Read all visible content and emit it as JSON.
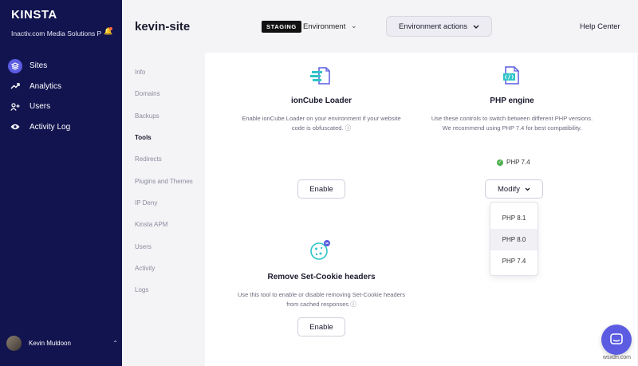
{
  "sidebar": {
    "logo": "KINSTA",
    "company": "Inactiv.com Media Solutions P",
    "bell_icon": "bell-icon",
    "items": [
      {
        "label": "Sites",
        "icon": "layers-icon",
        "active": true
      },
      {
        "label": "Analytics",
        "icon": "trend-icon",
        "active": false
      },
      {
        "label": "Users",
        "icon": "user-plus-icon",
        "active": false
      },
      {
        "label": "Activity Log",
        "icon": "eye-icon",
        "active": false
      }
    ],
    "user": {
      "name": "Kevin Muldoon",
      "caret": "⌃"
    }
  },
  "header": {
    "site_title": "kevin-site",
    "environment_badge": "STAGING",
    "environment_label": "Environment",
    "environment_caret": "⌄",
    "environment_actions": "Environment actions",
    "help": "Help Center"
  },
  "subnav": [
    "Info",
    "Domains",
    "Backups",
    "Tools",
    "Redirects",
    "Plugins and Themes",
    "IP Deny",
    "Kinsta APM",
    "Users",
    "Activity",
    "Logs"
  ],
  "subnav_active": "Tools",
  "tools": {
    "ioncube": {
      "title": "ionCube Loader",
      "description": "Enable ionCube Loader on your environment if your website code is obfuscated.",
      "button": "Enable"
    },
    "php": {
      "title": "PHP engine",
      "description": "Use these controls to switch between different PHP versions. We recommend using PHP 7.4 for best compatibility.",
      "status": "PHP 7.4",
      "button": "Modify",
      "options": [
        "PHP 8.1",
        "PHP 8.0",
        "PHP 7.4"
      ],
      "hovered_option": "PHP 8.0"
    },
    "cookie": {
      "title": "Remove Set-Cookie headers",
      "description": "Use this tool to enable or disable removing Set-Cookie headers from cached responses",
      "button": "Enable"
    }
  },
  "colors": {
    "sidebar": "#12144f",
    "accent": "#5b5ce2",
    "success": "#4caf50"
  },
  "watermark": "wsxdn.com"
}
